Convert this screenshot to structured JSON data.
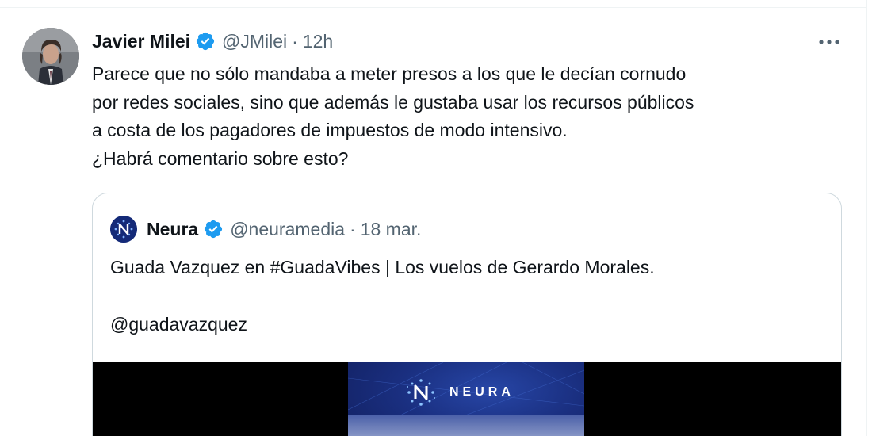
{
  "tweet": {
    "author_name": "Javier Milei",
    "handle": "@JMilei",
    "separator": "·",
    "time": "12h",
    "lines": [
      "Parece que no sólo mandaba a meter presos a los que le decían cornudo",
      "por redes sociales, sino que además le gustaba usar los recursos públicos",
      "a costa de los pagadores de impuestos de modo intensivo.",
      "¿Habrá comentario sobre esto?"
    ]
  },
  "quoted_tweet": {
    "author_name": "Neura",
    "handle": "@neuramedia",
    "separator": "·",
    "time": "18 mar.",
    "line1": "Guada Vazquez en #GuadaVibes |  Los vuelos de Gerardo Morales.",
    "line2": "@guadavazquez",
    "media_brand": "NEURA"
  },
  "icons": {
    "verified": "verified-badge-icon",
    "more": "more-options-icon"
  },
  "colors": {
    "verified_blue": "#1d9bf0",
    "secondary_text": "#536471",
    "border": "#cfd9de"
  }
}
